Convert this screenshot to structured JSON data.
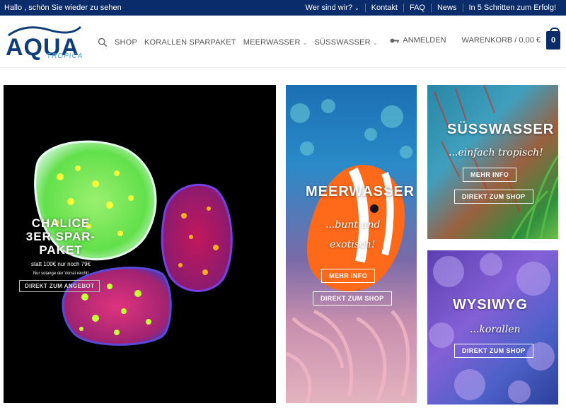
{
  "topbar": {
    "greeting": "Hallo , schön Sie wieder zu sehen",
    "links": [
      "Wer sind wir?",
      "Kontakt",
      "FAQ",
      "News",
      "In 5 Schritten zum Erfolg!"
    ]
  },
  "header": {
    "logo_main": "AQUA",
    "logo_sub": "TROPICA",
    "menu": [
      "SHOP",
      "KORALLEN SPARPAKET",
      "MEERWASSER",
      "SÜSSWASSER"
    ],
    "login": "ANMELDEN",
    "cart": "WARENKORB / 0,00 €",
    "cart_count": "0"
  },
  "banners": {
    "corals": {
      "title_line1": "CHALICE",
      "title_line2": "3ER SPAR-",
      "title_line3": "PAKET",
      "price": "statt 100€ nur noch 79€",
      "note": "Nur solange der Vorrat reicht!",
      "button": "DIREKT ZUM ANGEBOT"
    },
    "marine": {
      "heading": "MEERWASSER",
      "script_line1": "...bunt und",
      "script_line2": "exotisch!",
      "button_info": "MEHR INFO",
      "button_shop": "DIREKT ZUM SHOP"
    },
    "freshwater": {
      "heading": "SÜSSWASSER",
      "script": "...einfach tropisch!",
      "button_info": "MEHR INFO",
      "button_shop": "DIREKT ZUM SHOP"
    },
    "wysiwyg": {
      "heading": "WYSIWYG",
      "script": "...korallen",
      "button_shop": "DIREKT ZUM SHOP"
    }
  },
  "colors": {
    "brand_navy": "#0a2c6b",
    "logo_blue": "#0f3d7a",
    "logo_light": "#3da4d8"
  }
}
